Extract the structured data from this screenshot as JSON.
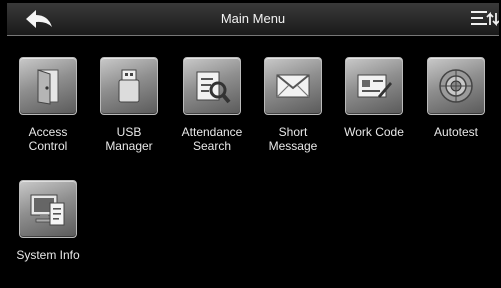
{
  "header": {
    "title": "Main Menu"
  },
  "icons": {
    "back": "back-arrow-icon",
    "menu": "menu-sort-icon"
  },
  "menu": {
    "items": [
      {
        "label": "Access\nControl",
        "icon": "door-icon"
      },
      {
        "label": "USB\nManager",
        "icon": "usb-drive-icon"
      },
      {
        "label": "Attendance\nSearch",
        "icon": "magnifier-document-icon"
      },
      {
        "label": "Short\nMessage",
        "icon": "envelope-icon"
      },
      {
        "label": "Work Code",
        "icon": "card-pen-icon"
      },
      {
        "label": "Autotest",
        "icon": "target-icon"
      },
      {
        "label": "System Info",
        "icon": "computer-document-icon"
      }
    ]
  },
  "colors": {
    "background": "#000000",
    "header": "#2a2a2a",
    "label_text": "#e8e8e8"
  }
}
